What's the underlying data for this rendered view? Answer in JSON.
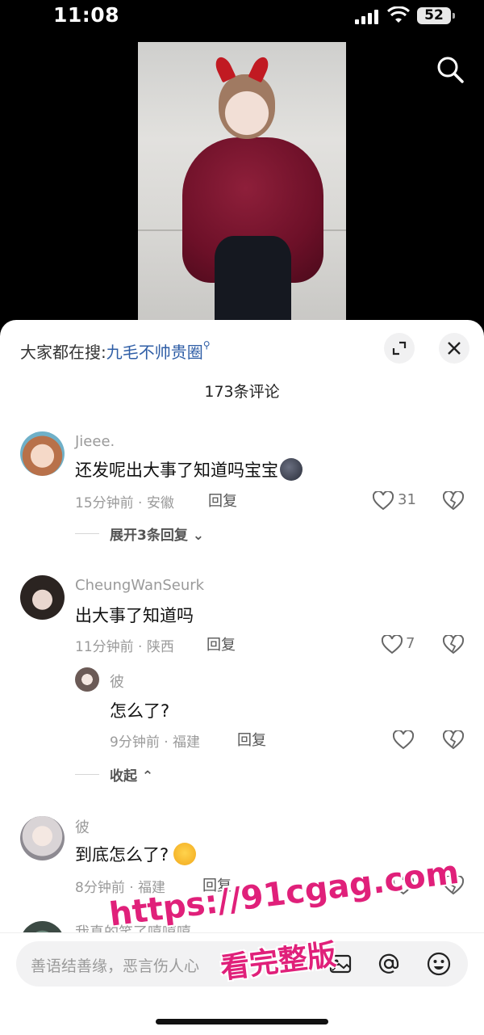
{
  "status_bar": {
    "time": "11:08",
    "battery": "52"
  },
  "sheet": {
    "search_prefix": "大家都在搜:",
    "search_term": "九毛不帅贵圈",
    "comment_count": "173条评论"
  },
  "comments": [
    {
      "user": "Jieee.",
      "text": "还发呢出大事了知道吗宝宝",
      "meta": "15分钟前 · 安徽",
      "reply": "回复",
      "likes": "31",
      "expand": "展开3条回复"
    },
    {
      "user": "CheungWanSeurk",
      "text": "出大事了知道吗",
      "meta": "11分钟前 · 陕西",
      "reply": "回复",
      "likes": "7"
    },
    {
      "user": "彼",
      "text": "怎么了?",
      "meta": "9分钟前 · 福建",
      "reply": "回复",
      "collapse": "收起"
    },
    {
      "user": "彼",
      "text": "到底怎么了?",
      "meta": "8分钟前 · 福建",
      "reply": "回复"
    },
    {
      "user": "我真的笑了嘻嘻嘻"
    }
  ],
  "input": {
    "placeholder": "善语结善缘，恶言伤人心"
  },
  "watermark": {
    "line1": "https://91cgag.com",
    "line2": "看完整版"
  },
  "colors": {
    "accent_link": "#2f5ea6",
    "watermark": "#e0207a"
  }
}
